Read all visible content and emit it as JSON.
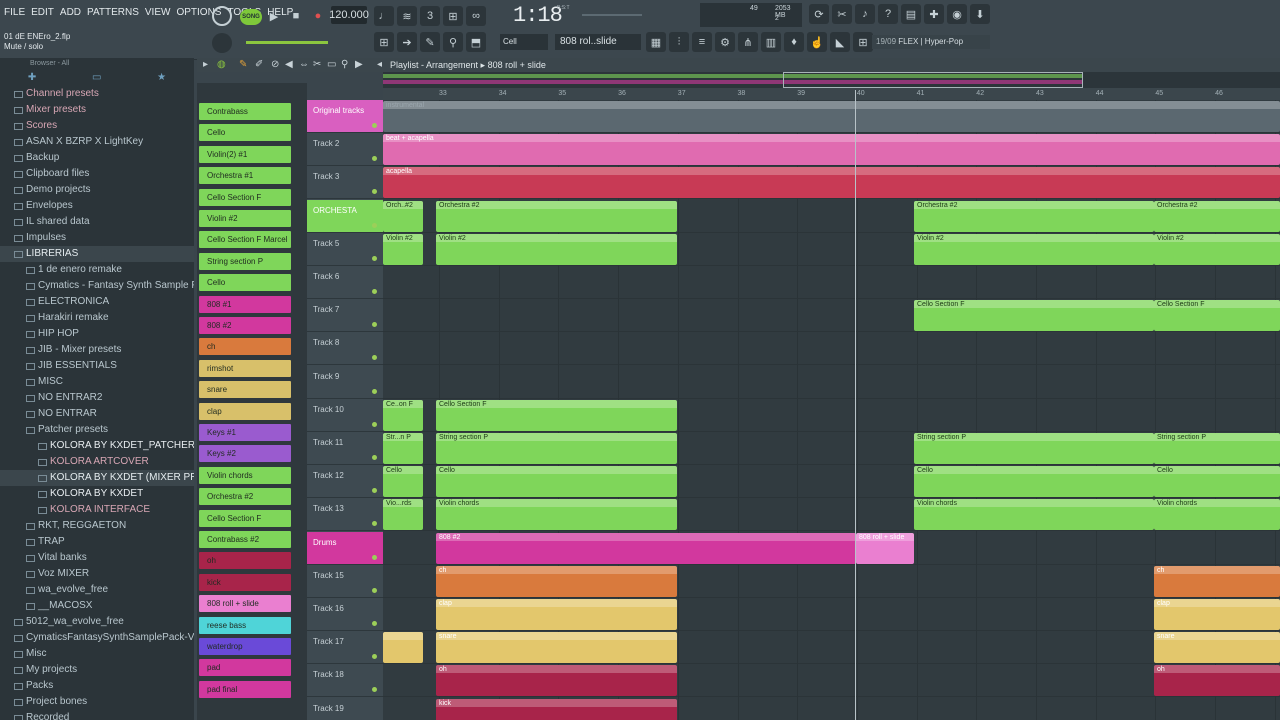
{
  "menu": [
    "FILE",
    "EDIT",
    "ADD",
    "PATTERNS",
    "VIEW",
    "OPTIONS",
    "TOOLS",
    "HELP"
  ],
  "project": {
    "filename": "01 dE ENEro_2.flp",
    "hint": "Mute / solo"
  },
  "transport": {
    "song_label": "SONG",
    "tempo": "120.000",
    "time": "1:18",
    "time_label": "B:S:T",
    "cpu_a": "49",
    "cpu_b": "2053 MB",
    "cpu_c": "2"
  },
  "toolbar2": {
    "snap": "Cell",
    "pattern": "808 rol..slide",
    "hint_num": "19/09",
    "hint_text": "FLEX | Hyper-Pop"
  },
  "browser": {
    "header": "Browser - All",
    "items": [
      {
        "label": "Channel presets",
        "style": "pink"
      },
      {
        "label": "Mixer presets",
        "style": "pink"
      },
      {
        "label": "Scores",
        "style": "pink"
      },
      {
        "label": "ASAN X BZRP X LightKey",
        "style": ""
      },
      {
        "label": "Backup",
        "style": ""
      },
      {
        "label": "Clipboard files",
        "style": ""
      },
      {
        "label": "Demo projects",
        "style": ""
      },
      {
        "label": "Envelopes",
        "style": ""
      },
      {
        "label": "IL shared data",
        "style": ""
      },
      {
        "label": "Impulses",
        "style": ""
      },
      {
        "label": "LIBRERIAS",
        "style": "sel"
      },
      {
        "label": "1 de enero remake",
        "style": ""
      },
      {
        "label": "Cymatics - Fantasy Synth Sample Pack",
        "style": ""
      },
      {
        "label": "ELECTRONICA",
        "style": ""
      },
      {
        "label": "Harakiri remake",
        "style": ""
      },
      {
        "label": "HIP HOP",
        "style": ""
      },
      {
        "label": "JIB - Mixer presets",
        "style": ""
      },
      {
        "label": "JIB ESSENTIALS",
        "style": ""
      },
      {
        "label": "MISC",
        "style": ""
      },
      {
        "label": "NO ENTRAR2",
        "style": ""
      },
      {
        "label": "NO ENTRAR",
        "style": ""
      },
      {
        "label": "Patcher presets",
        "style": ""
      },
      {
        "label": "KOLORA BY KXDET_PATCHER PRESET)",
        "style": "white"
      },
      {
        "label": "KOLORA ARTCOVER",
        "style": "pink"
      },
      {
        "label": "KOLORA BY KXDET (MIXER PRESET)",
        "style": "sel"
      },
      {
        "label": "KOLORA BY KXDET",
        "style": "white"
      },
      {
        "label": "KOLORA INTERFACE",
        "style": "pink"
      },
      {
        "label": "RKT, REGGAETON",
        "style": ""
      },
      {
        "label": "TRAP",
        "style": ""
      },
      {
        "label": "Vital banks",
        "style": ""
      },
      {
        "label": "Voz MIXER",
        "style": ""
      },
      {
        "label": "wa_evolve_free",
        "style": ""
      },
      {
        "label": "__MACOSX",
        "style": ""
      },
      {
        "label": "5012_wa_evolve_free",
        "style": ""
      },
      {
        "label": "CymaticsFantasySynthSamplePack-V2-f5p",
        "style": ""
      },
      {
        "label": "Misc",
        "style": ""
      },
      {
        "label": "My projects",
        "style": ""
      },
      {
        "label": "Packs",
        "style": ""
      },
      {
        "label": "Project bones",
        "style": ""
      },
      {
        "label": "Recorded",
        "style": ""
      }
    ]
  },
  "channels": [
    {
      "label": "Contrabass",
      "color": "#7fd65a"
    },
    {
      "label": "Cello",
      "color": "#7fd65a"
    },
    {
      "label": "Violin(2) #1",
      "color": "#7fd65a"
    },
    {
      "label": "Orchestra #1",
      "color": "#7fd65a"
    },
    {
      "label": "Cello Section F",
      "color": "#7fd65a"
    },
    {
      "label": "Violin #2",
      "color": "#7fd65a"
    },
    {
      "label": "Cello Section F Marcel",
      "color": "#7fd65a"
    },
    {
      "label": "String section P",
      "color": "#7fd65a"
    },
    {
      "label": "Cello",
      "color": "#7fd65a"
    },
    {
      "label": "808 #1",
      "color": "#d2389e"
    },
    {
      "label": "808 #2",
      "color": "#d2389e"
    },
    {
      "label": "ch",
      "color": "#d97a3d"
    },
    {
      "label": "rimshot",
      "color": "#d8c06a"
    },
    {
      "label": "snare",
      "color": "#d8c06a"
    },
    {
      "label": "clap",
      "color": "#d8c06a"
    },
    {
      "label": "Keys #1",
      "color": "#9a5bcf"
    },
    {
      "label": "Keys #2",
      "color": "#9a5bcf"
    },
    {
      "label": "Violin chords",
      "color": "#7fd65a"
    },
    {
      "label": "Orchestra #2",
      "color": "#7fd65a"
    },
    {
      "label": "Cello Section F",
      "color": "#7fd65a"
    },
    {
      "label": "Contrabass #2",
      "color": "#7fd65a"
    },
    {
      "label": "oh",
      "color": "#a8244a"
    },
    {
      "label": "kick",
      "color": "#a8244a"
    },
    {
      "label": "808 roll + slide",
      "color": "#ea7fd0"
    },
    {
      "label": "reese bass",
      "color": "#4fd4d8"
    },
    {
      "label": "waterdrop",
      "color": "#6a4ad8"
    },
    {
      "label": "pad",
      "color": "#d2389e"
    },
    {
      "label": "pad final",
      "color": "#d2389e"
    }
  ],
  "playlist": {
    "title": "Playlist - Arrangement",
    "pattern": "808 roll + slide"
  },
  "ruler": [
    "33",
    "34",
    "35",
    "36",
    "37",
    "38",
    "39",
    "40",
    "41",
    "42",
    "43",
    "44",
    "45",
    "46"
  ],
  "tracks": [
    {
      "label": "Original tracks",
      "color": "#d95fc0"
    },
    {
      "label": "Track 2",
      "color": ""
    },
    {
      "label": "Track 3",
      "color": ""
    },
    {
      "label": "ORCHESTA",
      "color": "#7fd65a"
    },
    {
      "label": "Track 5",
      "color": ""
    },
    {
      "label": "Track 6",
      "color": ""
    },
    {
      "label": "Track 7",
      "color": ""
    },
    {
      "label": "Track 8",
      "color": ""
    },
    {
      "label": "Track 9",
      "color": ""
    },
    {
      "label": "Track 10",
      "color": ""
    },
    {
      "label": "Track 11",
      "color": ""
    },
    {
      "label": "Track 12",
      "color": ""
    },
    {
      "label": "Track 13",
      "color": ""
    },
    {
      "label": "Drums",
      "color": "#d2389e"
    },
    {
      "label": "Track 15",
      "color": ""
    },
    {
      "label": "Track 16",
      "color": ""
    },
    {
      "label": "Track 17",
      "color": ""
    },
    {
      "label": "Track 18",
      "color": ""
    },
    {
      "label": "Track 19",
      "color": ""
    }
  ],
  "clips": [
    {
      "row": 0,
      "start": 0,
      "len": 897,
      "label": "instrumental",
      "color": "#5b6870",
      "text": "#9aa6ad"
    },
    {
      "row": 1,
      "start": 0,
      "len": 897,
      "label": "beat + acapella",
      "color": "#e06bb0",
      "text": "#fff"
    },
    {
      "row": 2,
      "start": 0,
      "len": 897,
      "label": "acapella",
      "color": "#c83a55",
      "text": "#fff"
    },
    {
      "row": 3,
      "start": 0,
      "len": 40,
      "label": "Orch..#2",
      "color": "#7fd65a",
      "text": "#1d3a17"
    },
    {
      "row": 3,
      "start": 53,
      "len": 241,
      "label": "Orchestra #2",
      "color": "#7fd65a",
      "text": "#1d3a17"
    },
    {
      "row": 3,
      "start": 531,
      "len": 240,
      "label": "Orchestra #2",
      "color": "#7fd65a",
      "text": "#1d3a17"
    },
    {
      "row": 3,
      "start": 771,
      "len": 126,
      "label": "Orchestra #2",
      "color": "#7fd65a",
      "text": "#1d3a17"
    },
    {
      "row": 4,
      "start": 0,
      "len": 40,
      "label": "Violin #2",
      "color": "#7fd65a",
      "text": "#1d3a17"
    },
    {
      "row": 4,
      "start": 53,
      "len": 241,
      "label": "Violin #2",
      "color": "#7fd65a",
      "text": "#1d3a17"
    },
    {
      "row": 4,
      "start": 531,
      "len": 240,
      "label": "Violin #2",
      "color": "#7fd65a",
      "text": "#1d3a17"
    },
    {
      "row": 4,
      "start": 771,
      "len": 126,
      "label": "Violin #2",
      "color": "#7fd65a",
      "text": "#1d3a17"
    },
    {
      "row": 6,
      "start": 531,
      "len": 240,
      "label": "Cello Section F",
      "color": "#7fd65a",
      "text": "#1d3a17"
    },
    {
      "row": 6,
      "start": 771,
      "len": 126,
      "label": "Cello Section F",
      "color": "#7fd65a",
      "text": "#1d3a17"
    },
    {
      "row": 9,
      "start": 0,
      "len": 40,
      "label": "Ce..on F",
      "color": "#7fd65a",
      "text": "#1d3a17"
    },
    {
      "row": 9,
      "start": 53,
      "len": 241,
      "label": "Cello Section F",
      "color": "#7fd65a",
      "text": "#1d3a17"
    },
    {
      "row": 10,
      "start": 0,
      "len": 40,
      "label": "Str...n P",
      "color": "#7fd65a",
      "text": "#1d3a17"
    },
    {
      "row": 10,
      "start": 53,
      "len": 241,
      "label": "String section P",
      "color": "#7fd65a",
      "text": "#1d3a17"
    },
    {
      "row": 10,
      "start": 531,
      "len": 240,
      "label": "String section P",
      "color": "#7fd65a",
      "text": "#1d3a17"
    },
    {
      "row": 10,
      "start": 771,
      "len": 126,
      "label": "String section P",
      "color": "#7fd65a",
      "text": "#1d3a17"
    },
    {
      "row": 11,
      "start": 0,
      "len": 40,
      "label": "Cello",
      "color": "#7fd65a",
      "text": "#1d3a17"
    },
    {
      "row": 11,
      "start": 53,
      "len": 241,
      "label": "Cello",
      "color": "#7fd65a",
      "text": "#1d3a17"
    },
    {
      "row": 11,
      "start": 531,
      "len": 240,
      "label": "Cello",
      "color": "#7fd65a",
      "text": "#1d3a17"
    },
    {
      "row": 11,
      "start": 771,
      "len": 126,
      "label": "Cello",
      "color": "#7fd65a",
      "text": "#1d3a17"
    },
    {
      "row": 12,
      "start": 0,
      "len": 40,
      "label": "Vio...rds",
      "color": "#7fd65a",
      "text": "#1d3a17"
    },
    {
      "row": 12,
      "start": 53,
      "len": 241,
      "label": "Violin chords",
      "color": "#7fd65a",
      "text": "#1d3a17"
    },
    {
      "row": 12,
      "start": 531,
      "len": 240,
      "label": "Violin chords",
      "color": "#7fd65a",
      "text": "#1d3a17"
    },
    {
      "row": 12,
      "start": 771,
      "len": 126,
      "label": "Violin chords",
      "color": "#7fd65a",
      "text": "#1d3a17"
    },
    {
      "row": 13,
      "start": 53,
      "len": 420,
      "label": "808 #2",
      "color": "#d2389e",
      "text": "#fff"
    },
    {
      "row": 13,
      "start": 473,
      "len": 58,
      "label": "808 roll + slide",
      "color": "#ea7fd0",
      "text": "#fff"
    },
    {
      "row": 14,
      "start": 53,
      "len": 241,
      "label": "ch",
      "color": "#d97a3d",
      "text": "#fff"
    },
    {
      "row": 14,
      "start": 771,
      "len": 126,
      "label": "ch",
      "color": "#d97a3d",
      "text": "#fff"
    },
    {
      "row": 15,
      "start": 53,
      "len": 241,
      "label": "clap",
      "color": "#e3c76c",
      "text": "#fff"
    },
    {
      "row": 15,
      "start": 771,
      "len": 126,
      "label": "clap",
      "color": "#e3c76c",
      "text": "#fff"
    },
    {
      "row": 16,
      "start": 0,
      "len": 40,
      "label": "",
      "color": "#e3c76c",
      "text": "#fff"
    },
    {
      "row": 16,
      "start": 53,
      "len": 241,
      "label": "snare",
      "color": "#e3c76c",
      "text": "#fff"
    },
    {
      "row": 16,
      "start": 771,
      "len": 126,
      "label": "snare",
      "color": "#e3c76c",
      "text": "#fff"
    },
    {
      "row": 17,
      "start": 53,
      "len": 241,
      "label": "oh",
      "color": "#a8244a",
      "text": "#fff"
    },
    {
      "row": 17,
      "start": 771,
      "len": 126,
      "label": "oh",
      "color": "#a8244a",
      "text": "#fff"
    },
    {
      "row": 18,
      "start": 53,
      "len": 241,
      "label": "kick",
      "color": "#a8244a",
      "text": "#fff"
    }
  ]
}
